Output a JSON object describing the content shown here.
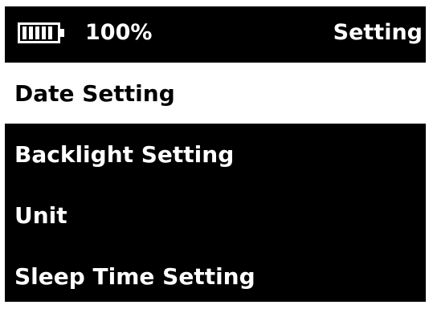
{
  "status_bar": {
    "battery_icon": "battery-full-icon",
    "battery_level": 100,
    "battery_text": "100%",
    "title": "Setting"
  },
  "menu": {
    "selected_index": 0,
    "items": [
      {
        "label": "Date Setting"
      },
      {
        "label": "Backlight Setting"
      },
      {
        "label": "Unit"
      },
      {
        "label": "Sleep Time Setting"
      }
    ]
  },
  "colors": {
    "background": "#000000",
    "foreground": "#ffffff",
    "selected_background": "#ffffff",
    "selected_foreground": "#000000"
  }
}
